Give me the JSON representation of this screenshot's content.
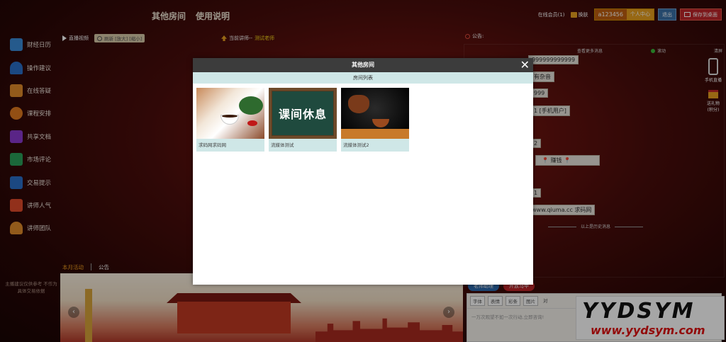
{
  "topbar": {
    "nav": [
      "其他房间",
      "使用说明"
    ],
    "online": "在线会员(1)",
    "skin": "换肤",
    "username": "a123456",
    "user_center": "个人中心",
    "logout": "退出",
    "save_desktop": "保存到桌面"
  },
  "sidebar": {
    "items": [
      {
        "label": "财经日历",
        "icon": "calendar-icon",
        "color": "#3a8ad8"
      },
      {
        "label": "操作建议",
        "icon": "bell-icon",
        "color": "#2a6fc8"
      },
      {
        "label": "在线答疑",
        "icon": "document-icon",
        "color": "#e08a2a"
      },
      {
        "label": "课程安排",
        "icon": "user-schedule-icon",
        "color": "#e07a20"
      },
      {
        "label": "共享文档",
        "icon": "chart-line-icon",
        "color": "#8a3ad0"
      },
      {
        "label": "市场评论",
        "icon": "books-icon",
        "color": "#2aa05a"
      },
      {
        "label": "交易提示",
        "icon": "mail-icon",
        "color": "#2a6fc8"
      },
      {
        "label": "讲师人气",
        "icon": "thumbs-up-icon",
        "color": "#e04a2a"
      },
      {
        "label": "讲师团队",
        "icon": "person-icon",
        "color": "#e08a2a"
      }
    ],
    "note": "主播建议仅供参考 不作为具体交易依据"
  },
  "video": {
    "live_label": "直播视频",
    "refresh_label": "刷新 [放大] [缩小]",
    "teacher_prefix": "当前讲师--",
    "teacher_name": "测试老师"
  },
  "notice": {
    "title": "公告:",
    "more_messages": "查看更多消息",
    "scroll": "滚动",
    "clear": "清屏",
    "messages": [
      "999999999999",
      "有杂音",
      "999",
      "1 [手机用户]",
      "2",
      "📍 赚钱 📍",
      "1",
      "www.qiuma.cc 求码网"
    ],
    "history": "以上是历史消息"
  },
  "side_tools": {
    "phone": "手机直播",
    "gift": "送礼物",
    "gift_sub": "(积分)"
  },
  "bottom": {
    "tab_active": "本月活动",
    "tab_other": "公告"
  },
  "compose": {
    "tab1": "老师助理",
    "tab2": "开放马甲",
    "tools": [
      "字体",
      "表情",
      "彩条",
      "图片"
    ],
    "to_label": "对",
    "placeholder": "一万次观望不如一次行动,立即咨询!"
  },
  "watermark": {
    "title": "YYDSYM",
    "url": "www.yydsym.com"
  },
  "modal": {
    "title": "其他房间",
    "close": "✕",
    "subtitle": "房间列表",
    "rooms": [
      {
        "name": "求码网求码网"
      },
      {
        "name": "流媒体测试",
        "thumb_text": "课间休息"
      },
      {
        "name": "流媒体测试2"
      }
    ]
  }
}
